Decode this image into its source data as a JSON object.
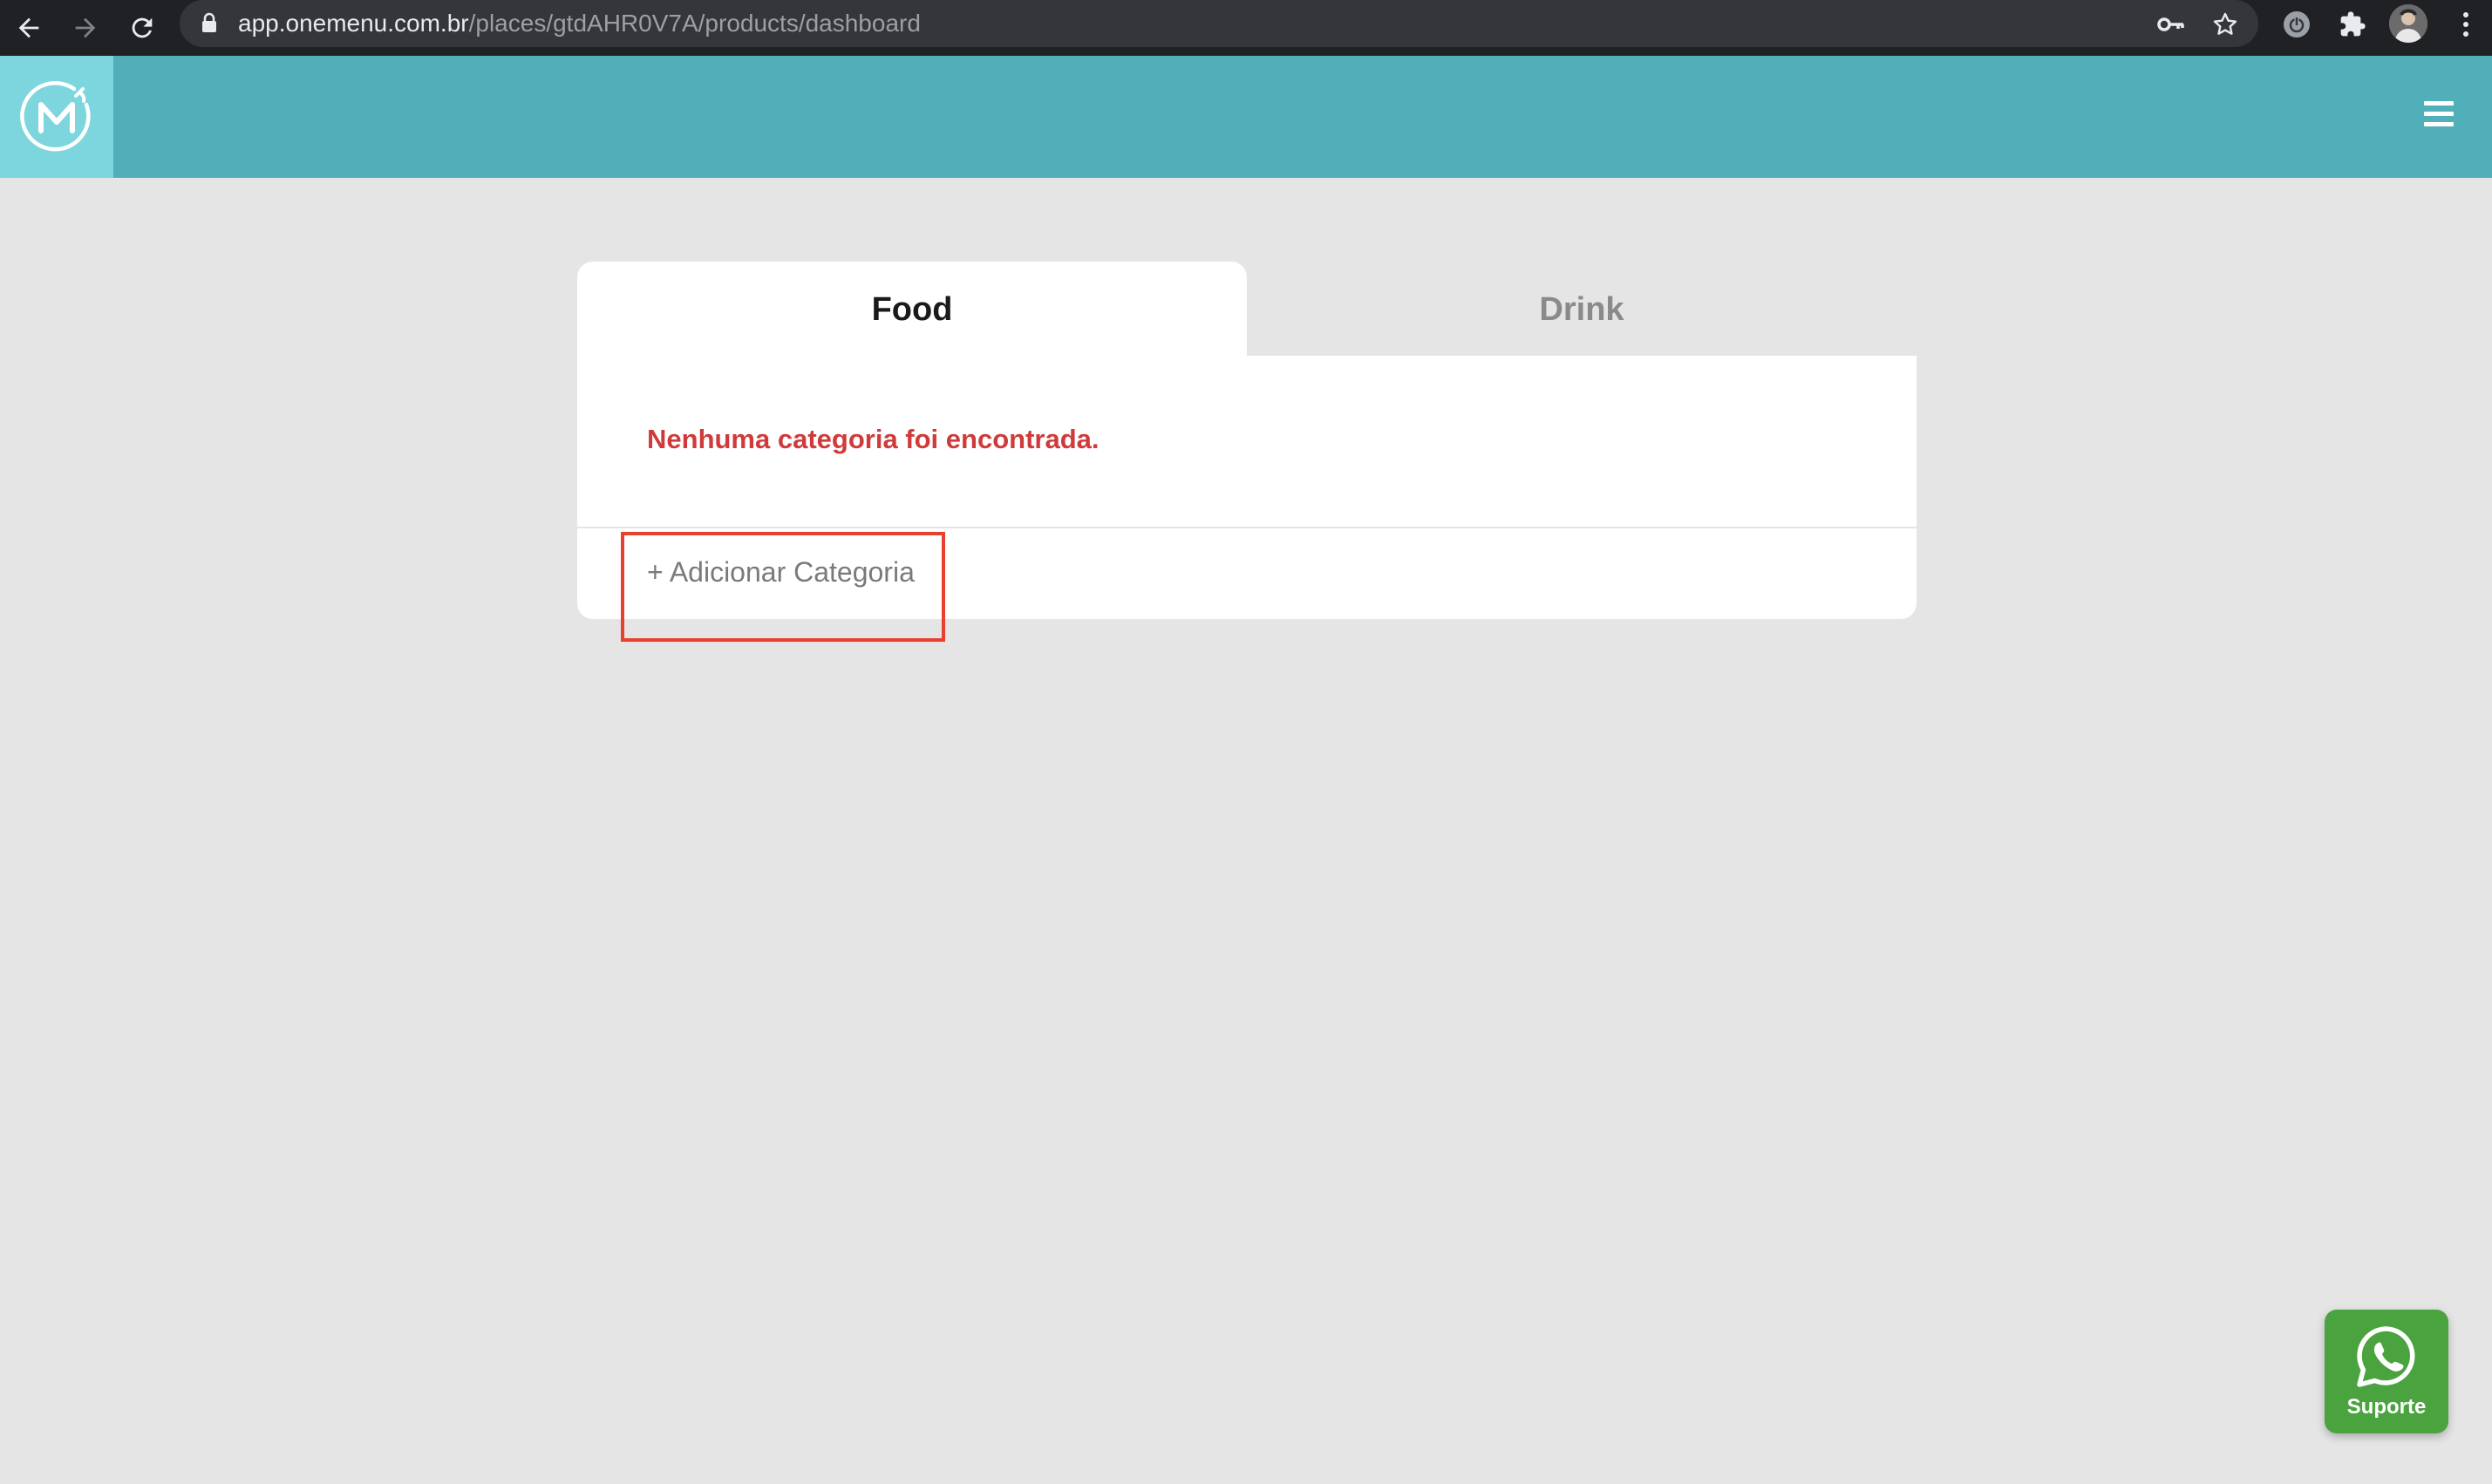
{
  "browser": {
    "url_domain": "app.onemenu.com.br",
    "url_path": "/places/gtdAHR0V7A/products/dashboard"
  },
  "header": {
    "logo_letter": "M"
  },
  "tabs": [
    {
      "label": "Food",
      "active": true
    },
    {
      "label": "Drink",
      "active": false
    }
  ],
  "content": {
    "empty_message": "Nenhuma categoria foi encontrada.",
    "add_category_label": "+ Adicionar Categoria"
  },
  "support": {
    "label": "Suporte"
  },
  "colors": {
    "header": "#50afb8",
    "logo_bg": "#7dd6de",
    "error_text": "#d03a3a",
    "highlight": "#e8412f",
    "support_bg": "#4aa33e"
  },
  "icons": [
    "back-arrow-icon",
    "forward-arrow-icon",
    "reload-icon",
    "lock-icon",
    "key-icon",
    "star-icon",
    "power-icon",
    "puzzle-icon",
    "kebab-menu-icon",
    "hamburger-icon",
    "whatsapp-icon"
  ]
}
